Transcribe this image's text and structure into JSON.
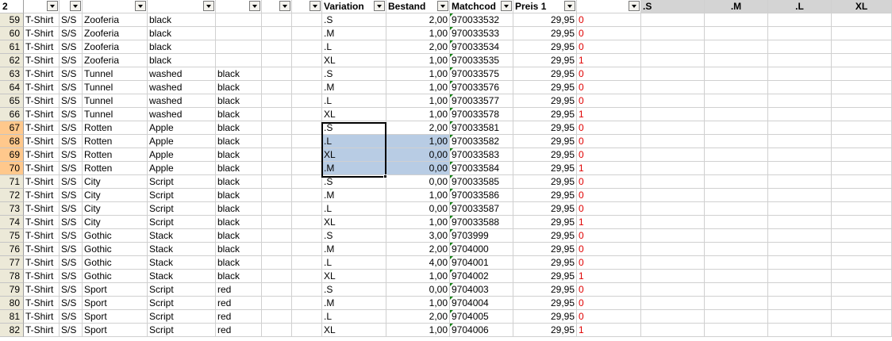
{
  "header": {
    "row_number": "2",
    "variation": "Variation",
    "bestand": "Bestand",
    "matchcode": "Matchcod",
    "preis": "Preis 1",
    "size_s": ".S",
    "size_m": ".M",
    "size_l": ".L",
    "size_xl": "XL"
  },
  "rows": [
    {
      "n": "59",
      "c1": "T-Shirt",
      "c2": "S/S",
      "c3": "Zooferia",
      "c4": "black",
      "c5": "",
      "var": ".S",
      "bestand": "2,00",
      "match": "970033532",
      "preis": "29,95",
      "flag": "0"
    },
    {
      "n": "60",
      "c1": "T-Shirt",
      "c2": "S/S",
      "c3": "Zooferia",
      "c4": "black",
      "c5": "",
      "var": ".M",
      "bestand": "1,00",
      "match": "970033533",
      "preis": "29,95",
      "flag": "0"
    },
    {
      "n": "61",
      "c1": "T-Shirt",
      "c2": "S/S",
      "c3": "Zooferia",
      "c4": "black",
      "c5": "",
      "var": ".L",
      "bestand": "2,00",
      "match": "970033534",
      "preis": "29,95",
      "flag": "0"
    },
    {
      "n": "62",
      "c1": "T-Shirt",
      "c2": "S/S",
      "c3": "Zooferia",
      "c4": "black",
      "c5": "",
      "var": "XL",
      "bestand": "1,00",
      "match": "970033535",
      "preis": "29,95",
      "flag": "1"
    },
    {
      "n": "63",
      "c1": "T-Shirt",
      "c2": "S/S",
      "c3": "Tunnel",
      "c4": "washed",
      "c5": "black",
      "var": ".S",
      "bestand": "1,00",
      "match": "970033575",
      "preis": "29,95",
      "flag": "0"
    },
    {
      "n": "64",
      "c1": "T-Shirt",
      "c2": "S/S",
      "c3": "Tunnel",
      "c4": "washed",
      "c5": "black",
      "var": ".M",
      "bestand": "1,00",
      "match": "970033576",
      "preis": "29,95",
      "flag": "0"
    },
    {
      "n": "65",
      "c1": "T-Shirt",
      "c2": "S/S",
      "c3": "Tunnel",
      "c4": "washed",
      "c5": "black",
      "var": ".L",
      "bestand": "1,00",
      "match": "970033577",
      "preis": "29,95",
      "flag": "0"
    },
    {
      "n": "66",
      "c1": "T-Shirt",
      "c2": "S/S",
      "c3": "Tunnel",
      "c4": "washed",
      "c5": "black",
      "var": "XL",
      "bestand": "1,00",
      "match": "970033578",
      "preis": "29,95",
      "flag": "1"
    },
    {
      "n": "67",
      "c1": "T-Shirt",
      "c2": "S/S",
      "c3": "Rotten",
      "c4": "Apple",
      "c5": "black",
      "var": ".S",
      "bestand": "2,00",
      "match": "970033581",
      "preis": "29,95",
      "flag": "0",
      "sel": true
    },
    {
      "n": "68",
      "c1": "T-Shirt",
      "c2": "S/S",
      "c3": "Rotten",
      "c4": "Apple",
      "c5": "black",
      "var": ".L",
      "bestand": "1,00",
      "match": "970033582",
      "preis": "29,95",
      "flag": "0",
      "sel": true,
      "hl": true
    },
    {
      "n": "69",
      "c1": "T-Shirt",
      "c2": "S/S",
      "c3": "Rotten",
      "c4": "Apple",
      "c5": "black",
      "var": "XL",
      "bestand": "0,00",
      "match": "970033583",
      "preis": "29,95",
      "flag": "0",
      "sel": true,
      "hl": true
    },
    {
      "n": "70",
      "c1": "T-Shirt",
      "c2": "S/S",
      "c3": "Rotten",
      "c4": "Apple",
      "c5": "black",
      "var": ".M",
      "bestand": "0,00",
      "match": "970033584",
      "preis": "29,95",
      "flag": "1",
      "sel": true,
      "hl": true
    },
    {
      "n": "71",
      "c1": "T-Shirt",
      "c2": "S/S",
      "c3": "City",
      "c4": "Script",
      "c5": "black",
      "var": ".S",
      "bestand": "0,00",
      "match": "970033585",
      "preis": "29,95",
      "flag": "0"
    },
    {
      "n": "72",
      "c1": "T-Shirt",
      "c2": "S/S",
      "c3": "City",
      "c4": "Script",
      "c5": "black",
      "var": ".M",
      "bestand": "1,00",
      "match": "970033586",
      "preis": "29,95",
      "flag": "0"
    },
    {
      "n": "73",
      "c1": "T-Shirt",
      "c2": "S/S",
      "c3": "City",
      "c4": "Script",
      "c5": "black",
      "var": ".L",
      "bestand": "0,00",
      "match": "970033587",
      "preis": "29,95",
      "flag": "0"
    },
    {
      "n": "74",
      "c1": "T-Shirt",
      "c2": "S/S",
      "c3": "City",
      "c4": "Script",
      "c5": "black",
      "var": "XL",
      "bestand": "1,00",
      "match": "970033588",
      "preis": "29,95",
      "flag": "1"
    },
    {
      "n": "75",
      "c1": "T-Shirt",
      "c2": "S/S",
      "c3": "Gothic",
      "c4": "Stack",
      "c5": "black",
      "var": ".S",
      "bestand": "3,00",
      "match": "9703999",
      "preis": "29,95",
      "flag": "0"
    },
    {
      "n": "76",
      "c1": "T-Shirt",
      "c2": "S/S",
      "c3": "Gothic",
      "c4": "Stack",
      "c5": "black",
      "var": ".M",
      "bestand": "2,00",
      "match": "9704000",
      "preis": "29,95",
      "flag": "0"
    },
    {
      "n": "77",
      "c1": "T-Shirt",
      "c2": "S/S",
      "c3": "Gothic",
      "c4": "Stack",
      "c5": "black",
      "var": ".L",
      "bestand": "4,00",
      "match": "9704001",
      "preis": "29,95",
      "flag": "0"
    },
    {
      "n": "78",
      "c1": "T-Shirt",
      "c2": "S/S",
      "c3": "Gothic",
      "c4": "Stack",
      "c5": "black",
      "var": "XL",
      "bestand": "1,00",
      "match": "9704002",
      "preis": "29,95",
      "flag": "1"
    },
    {
      "n": "79",
      "c1": "T-Shirt",
      "c2": "S/S",
      "c3": "Sport",
      "c4": "Script",
      "c5": "red",
      "var": ".S",
      "bestand": "0,00",
      "match": "9704003",
      "preis": "29,95",
      "flag": "0"
    },
    {
      "n": "80",
      "c1": "T-Shirt",
      "c2": "S/S",
      "c3": "Sport",
      "c4": "Script",
      "c5": "red",
      "var": ".M",
      "bestand": "1,00",
      "match": "9704004",
      "preis": "29,95",
      "flag": "0"
    },
    {
      "n": "81",
      "c1": "T-Shirt",
      "c2": "S/S",
      "c3": "Sport",
      "c4": "Script",
      "c5": "red",
      "var": ".L",
      "bestand": "2,00",
      "match": "9704005",
      "preis": "29,95",
      "flag": "0"
    },
    {
      "n": "82",
      "c1": "T-Shirt",
      "c2": "S/S",
      "c3": "Sport",
      "c4": "Script",
      "c5": "red",
      "var": "XL",
      "bestand": "1,00",
      "match": "9704006",
      "preis": "29,95",
      "flag": "1"
    }
  ],
  "colors": {
    "selection_fill": "#b8cce4",
    "row_header_selected": "#ffc88c",
    "flag_red": "#e00000"
  }
}
